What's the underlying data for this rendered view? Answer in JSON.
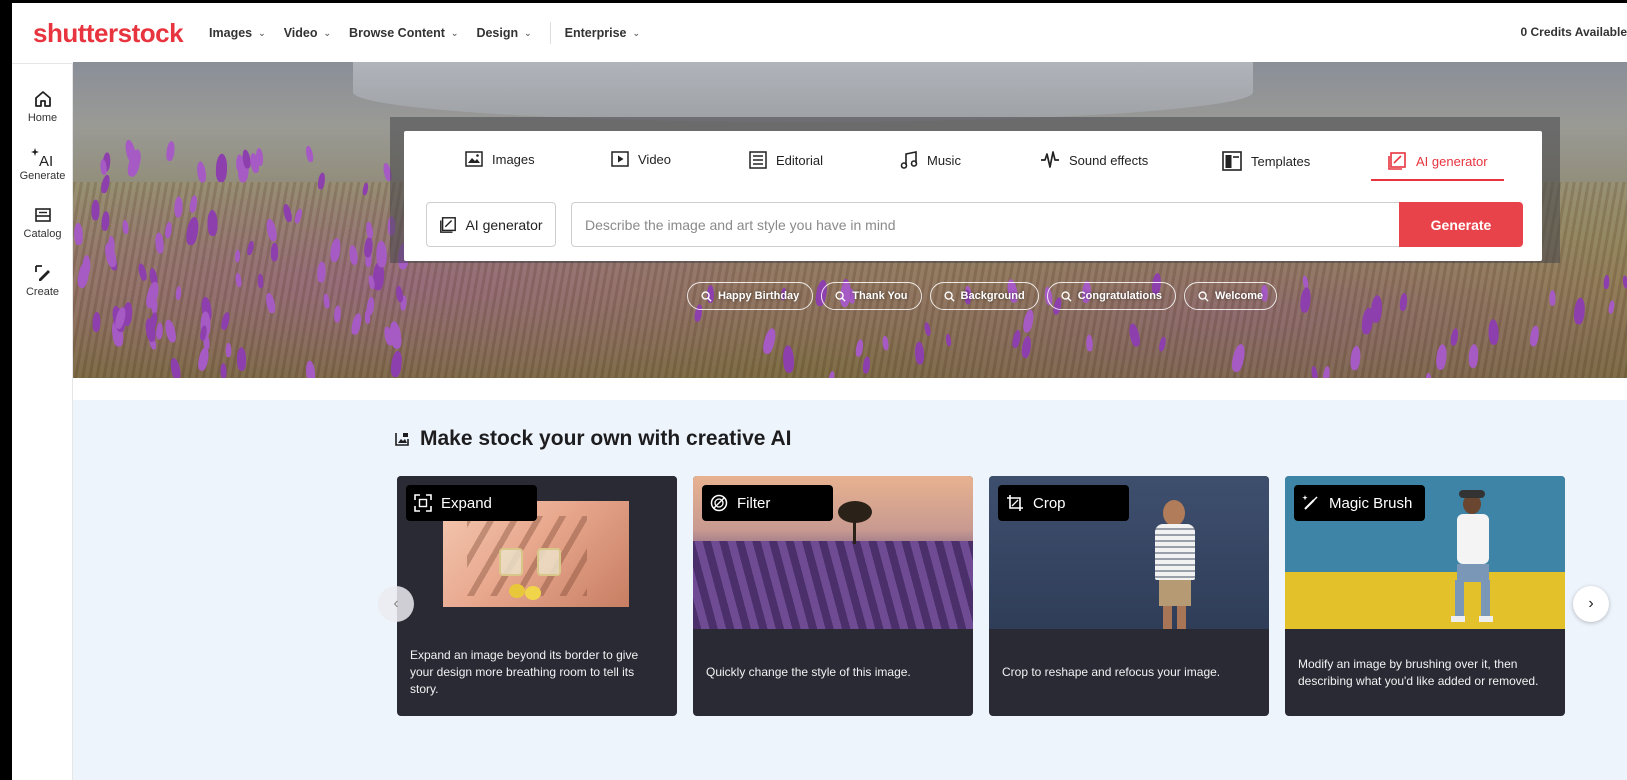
{
  "brand": {
    "logo_text": "shutterstock",
    "accent": "#e8343e"
  },
  "topnav": {
    "items": [
      {
        "label": "Images"
      },
      {
        "label": "Video"
      },
      {
        "label": "Browse Content"
      },
      {
        "label": "Design"
      },
      {
        "label": "Enterprise"
      }
    ],
    "credits": "0 Credits Available"
  },
  "sidebar": {
    "items": [
      {
        "label": "Home",
        "icon": "home-icon"
      },
      {
        "label": "Generate",
        "icon": "ai-sparkle-icon"
      },
      {
        "label": "Catalog",
        "icon": "catalog-icon"
      },
      {
        "label": "Create",
        "icon": "edit-icon"
      }
    ]
  },
  "search": {
    "tabs": [
      {
        "label": "Images"
      },
      {
        "label": "Video"
      },
      {
        "label": "Editorial"
      },
      {
        "label": "Music"
      },
      {
        "label": "Sound effects"
      },
      {
        "label": "Templates"
      },
      {
        "label": "AI generator"
      }
    ],
    "active_tab": "AI generator",
    "mode_label": "AI generator",
    "placeholder": "Describe the image and art style you have in mind",
    "generate_label": "Generate"
  },
  "chips": [
    "Happy Birthday",
    "Thank You",
    "Background",
    "Congratulations",
    "Welcome"
  ],
  "section": {
    "title": "Make stock your own with creative AI",
    "cards": [
      {
        "label": "Expand",
        "desc": "Expand an image beyond its border to give your design more breathing room to tell its story."
      },
      {
        "label": "Filter",
        "desc": "Quickly change the style of this image."
      },
      {
        "label": "Crop",
        "desc": "Crop to reshape and refocus your image."
      },
      {
        "label": "Magic Brush",
        "desc": "Modify an image by brushing over it, then describing what you'd like added or removed."
      }
    ]
  }
}
